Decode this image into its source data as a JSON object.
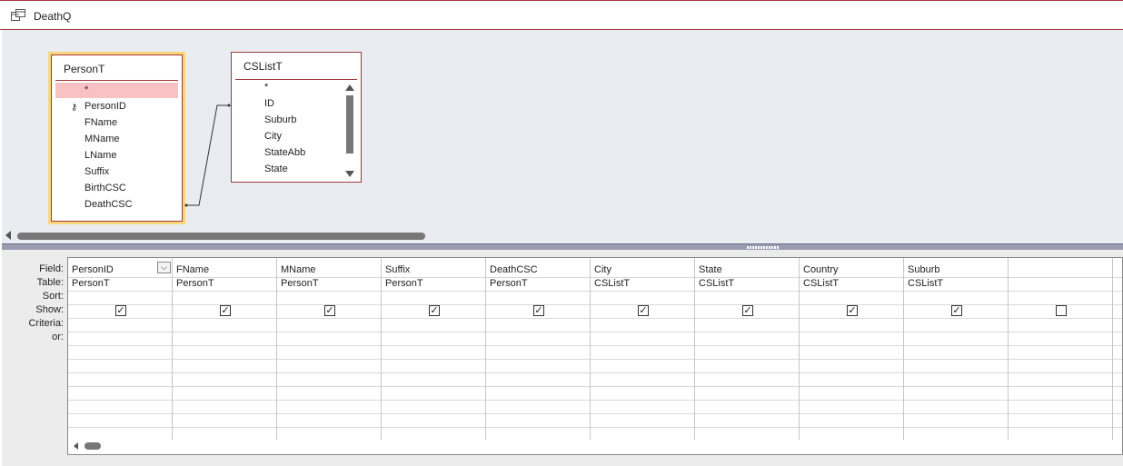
{
  "window": {
    "title": "DeathQ",
    "icon": "query-icon"
  },
  "tables": [
    {
      "name": "PersonT",
      "fields": [
        "*",
        "PersonID",
        "FName",
        "MName",
        "LName",
        "Suffix",
        "BirthCSC",
        "DeathCSC"
      ],
      "primary_key": "PersonID",
      "selected": true
    },
    {
      "name": "CSListT",
      "fields": [
        "*",
        "ID",
        "Suburb",
        "City",
        "StateAbb",
        "State"
      ],
      "selected": false
    }
  ],
  "grid": {
    "row_labels": [
      "Field:",
      "Table:",
      "Sort:",
      "Show:",
      "Criteria:",
      "or:"
    ],
    "columns": [
      {
        "field": "PersonID",
        "table": "PersonT",
        "show": true
      },
      {
        "field": "FName",
        "table": "PersonT",
        "show": true
      },
      {
        "field": "MName",
        "table": "PersonT",
        "show": true
      },
      {
        "field": "Suffix",
        "table": "PersonT",
        "show": true
      },
      {
        "field": "DeathCSC",
        "table": "PersonT",
        "show": true
      },
      {
        "field": "City",
        "table": "CSListT",
        "show": true
      },
      {
        "field": "State",
        "table": "CSListT",
        "show": true
      },
      {
        "field": "Country",
        "table": "CSListT",
        "show": true
      },
      {
        "field": "Suburb",
        "table": "CSListT",
        "show": true
      },
      {
        "field": "",
        "table": "",
        "show": false
      }
    ]
  },
  "colors": {
    "accent": "#a4373a",
    "highlight": "#f8c1c4",
    "selection_outline": "#fbd77a"
  }
}
